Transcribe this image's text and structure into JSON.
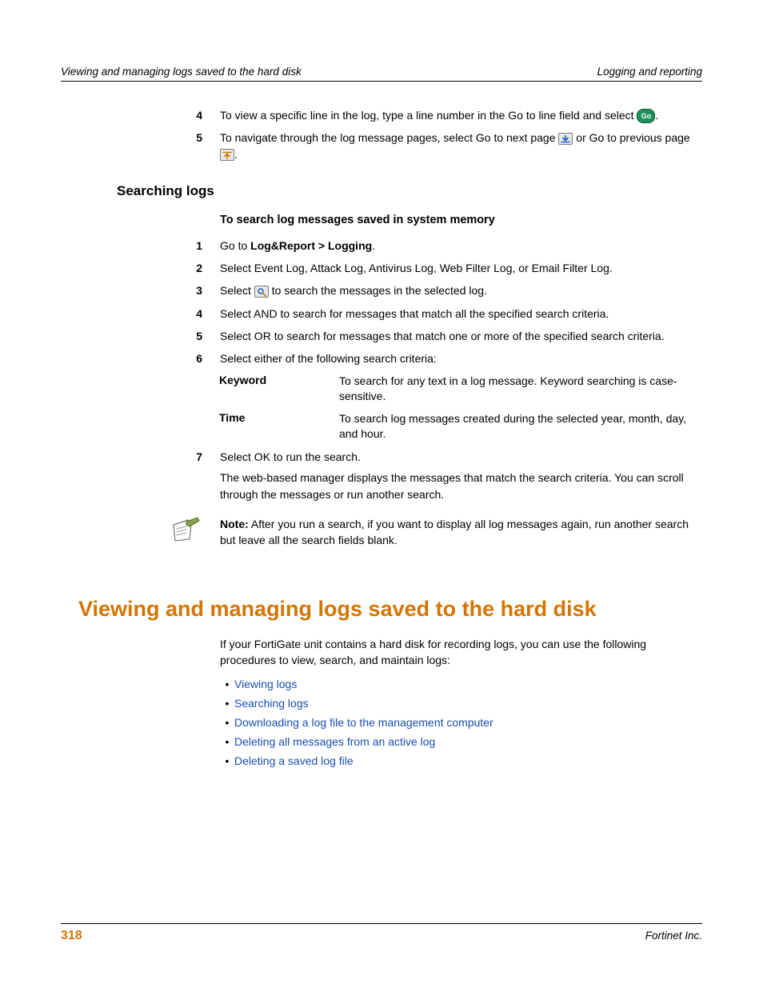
{
  "header": {
    "left": "Viewing and managing logs saved to the hard disk",
    "right": "Logging and reporting"
  },
  "prev_steps": {
    "s4_a": "To view a specific line in the log, type a line number in the Go to line field and select ",
    "s4_go_label": "Go",
    "s4_b": ".",
    "s5_a": "To navigate through the log message pages, select Go to next page ",
    "s5_b": " or Go to previous page ",
    "s5_c": "."
  },
  "searching": {
    "h3": "Searching logs",
    "proc_title": "To search log messages saved in system memory",
    "s1_a": "Go to ",
    "s1_b": "Log&Report > Logging",
    "s1_c": ".",
    "s2": "Select Event Log, Attack Log, Antivirus Log, Web Filter Log, or Email Filter Log.",
    "s3_a": "Select ",
    "s3_b": " to search the messages in the selected log.",
    "s4": "Select AND to search for messages that match all the specified search criteria.",
    "s5": "Select OR to search for messages that match one or more of the specified search criteria.",
    "s6": "Select either of the following search criteria:",
    "def": {
      "k1": "Keyword",
      "v1": "To search for any text in a log message. Keyword searching is case-sensitive.",
      "k2": "Time",
      "v2": "To search log messages created during the selected year, month, day, and hour."
    },
    "s7a": "Select OK to run the search.",
    "s7b": "The web-based manager displays the messages that match the search criteria. You can scroll through the messages or run another search.",
    "note_label": "Note:",
    "note_body": " After you run a search, if you want to display all log messages again, run another search but leave all the search fields blank."
  },
  "main": {
    "h1": "Viewing and managing logs saved to the hard disk",
    "intro": "If your FortiGate unit contains a hard disk for recording logs, you can use the following procedures to view, search, and maintain logs:",
    "links": [
      "Viewing logs",
      "Searching logs",
      "Downloading a log file to the management computer",
      "Deleting all messages from an active log",
      "Deleting a saved log file"
    ]
  },
  "nums": {
    "n1": "1",
    "n2": "2",
    "n3": "3",
    "n4": "4",
    "n5": "5",
    "n6": "6",
    "n7": "7"
  },
  "bullet": "•",
  "footer": {
    "page": "318",
    "right": "Fortinet Inc."
  }
}
